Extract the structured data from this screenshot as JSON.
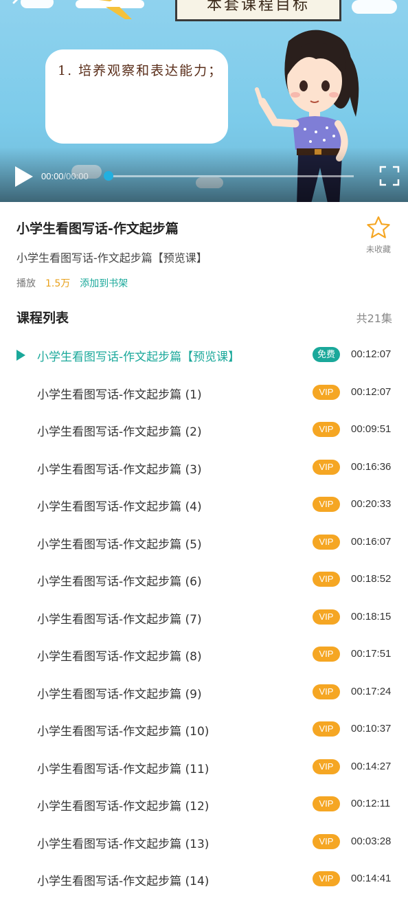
{
  "video": {
    "board_title": "本套课程目标",
    "bubble_text": "1. 培养观察和表达能力；",
    "current_time": "00:00",
    "duration": "00:00",
    "progress": 0
  },
  "course": {
    "title": "小学生看图写话-作文起步篇",
    "subtitle": "小学生看图写话-作文起步篇【预览课】",
    "favorite_label": "未收藏",
    "play_label": "播放",
    "play_count": "1.5万",
    "add_shelf_label": "添加到书架"
  },
  "list": {
    "header": "课程列表",
    "count": "共21集",
    "episodes": [
      {
        "title": "小学生看图写话-作文起步篇【预览课】",
        "badge": "免费",
        "badge_type": "free",
        "duration": "00:12:07",
        "active": true
      },
      {
        "title": "小学生看图写话-作文起步篇 (1)",
        "badge": "VIP",
        "badge_type": "vip",
        "duration": "00:12:07"
      },
      {
        "title": "小学生看图写话-作文起步篇 (2)",
        "badge": "VIP",
        "badge_type": "vip",
        "duration": "00:09:51"
      },
      {
        "title": "小学生看图写话-作文起步篇 (3)",
        "badge": "VIP",
        "badge_type": "vip",
        "duration": "00:16:36"
      },
      {
        "title": "小学生看图写话-作文起步篇 (4)",
        "badge": "VIP",
        "badge_type": "vip",
        "duration": "00:20:33"
      },
      {
        "title": "小学生看图写话-作文起步篇 (5)",
        "badge": "VIP",
        "badge_type": "vip",
        "duration": "00:16:07"
      },
      {
        "title": "小学生看图写话-作文起步篇 (6)",
        "badge": "VIP",
        "badge_type": "vip",
        "duration": "00:18:52"
      },
      {
        "title": "小学生看图写话-作文起步篇 (7)",
        "badge": "VIP",
        "badge_type": "vip",
        "duration": "00:18:15"
      },
      {
        "title": "小学生看图写话-作文起步篇 (8)",
        "badge": "VIP",
        "badge_type": "vip",
        "duration": "00:17:51"
      },
      {
        "title": "小学生看图写话-作文起步篇 (9)",
        "badge": "VIP",
        "badge_type": "vip",
        "duration": "00:17:24"
      },
      {
        "title": "小学生看图写话-作文起步篇 (10)",
        "badge": "VIP",
        "badge_type": "vip",
        "duration": "00:10:37"
      },
      {
        "title": "小学生看图写话-作文起步篇 (11)",
        "badge": "VIP",
        "badge_type": "vip",
        "duration": "00:14:27"
      },
      {
        "title": "小学生看图写话-作文起步篇 (12)",
        "badge": "VIP",
        "badge_type": "vip",
        "duration": "00:12:11"
      },
      {
        "title": "小学生看图写话-作文起步篇 (13)",
        "badge": "VIP",
        "badge_type": "vip",
        "duration": "00:03:28"
      },
      {
        "title": "小学生看图写话-作文起步篇 (14)",
        "badge": "VIP",
        "badge_type": "vip",
        "duration": "00:14:41"
      }
    ]
  },
  "colors": {
    "accent": "#1aa89a",
    "vip": "#f5a623",
    "play_count": "#e8a11c",
    "progress": "#22b0e0"
  },
  "icons": {
    "back": "back-arrow-icon",
    "play": "play-icon",
    "fullscreen": "fullscreen-icon",
    "favorite": "star-outline-icon",
    "episode_playing": "play-triangle-icon"
  }
}
